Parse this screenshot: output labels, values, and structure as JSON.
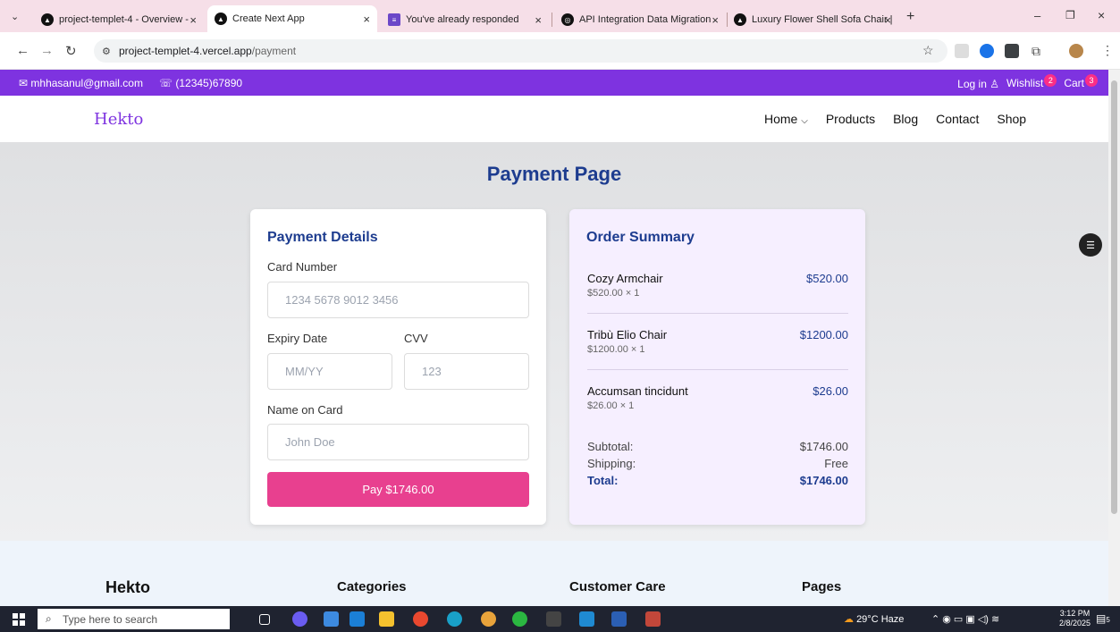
{
  "browser": {
    "tabs": [
      {
        "title": "project-templet-4 - Overview -"
      },
      {
        "title": "Create Next App"
      },
      {
        "title": "You've already responded"
      },
      {
        "title": "API Integration Data Migration"
      },
      {
        "title": "Luxury Flower Shell Sofa Chair |"
      }
    ],
    "new_tab": "+",
    "url_host": "project-templet-4.vercel.app",
    "url_path": "/payment"
  },
  "topbar": {
    "email": "mhhasanul@gmail.com",
    "phone": "(12345)67890",
    "login": "Log in",
    "wishlist": "Wishlist",
    "wishlist_count": "2",
    "cart": "Cart",
    "cart_count": "3"
  },
  "header": {
    "logo": "Hekto",
    "menu": [
      "Home",
      "Products",
      "Blog",
      "Contact",
      "Shop"
    ]
  },
  "page": {
    "title": "Payment Page"
  },
  "payment": {
    "heading": "Payment Details",
    "card_number_label": "Card Number",
    "card_number_placeholder": "1234 5678 9012 3456",
    "expiry_label": "Expiry Date",
    "expiry_placeholder": "MM/YY",
    "cvv_label": "CVV",
    "cvv_placeholder": "123",
    "name_label": "Name on Card",
    "name_placeholder": "John Doe",
    "pay_button": "Pay $1746.00"
  },
  "summary": {
    "heading": "Order Summary",
    "items": [
      {
        "name": "Cozy Armchair",
        "qty": "$520.00 × 1",
        "price": "$520.00"
      },
      {
        "name": "Tribù Elio Chair",
        "qty": "$1200.00 × 1",
        "price": "$1200.00"
      },
      {
        "name": "Accumsan tincidunt",
        "qty": "$26.00 × 1",
        "price": "$26.00"
      }
    ],
    "subtotal_label": "Subtotal:",
    "subtotal": "$1746.00",
    "shipping_label": "Shipping:",
    "shipping": "Free",
    "total_label": "Total:",
    "total": "$1746.00"
  },
  "footer": {
    "columns": [
      "Hekto",
      "Categories",
      "Customer Care",
      "Pages"
    ]
  },
  "taskbar": {
    "search_placeholder": "Type here to search",
    "weather": "29°C Haze",
    "time": "3:12 PM",
    "date": "2/8/2025",
    "notification_count": "5"
  }
}
